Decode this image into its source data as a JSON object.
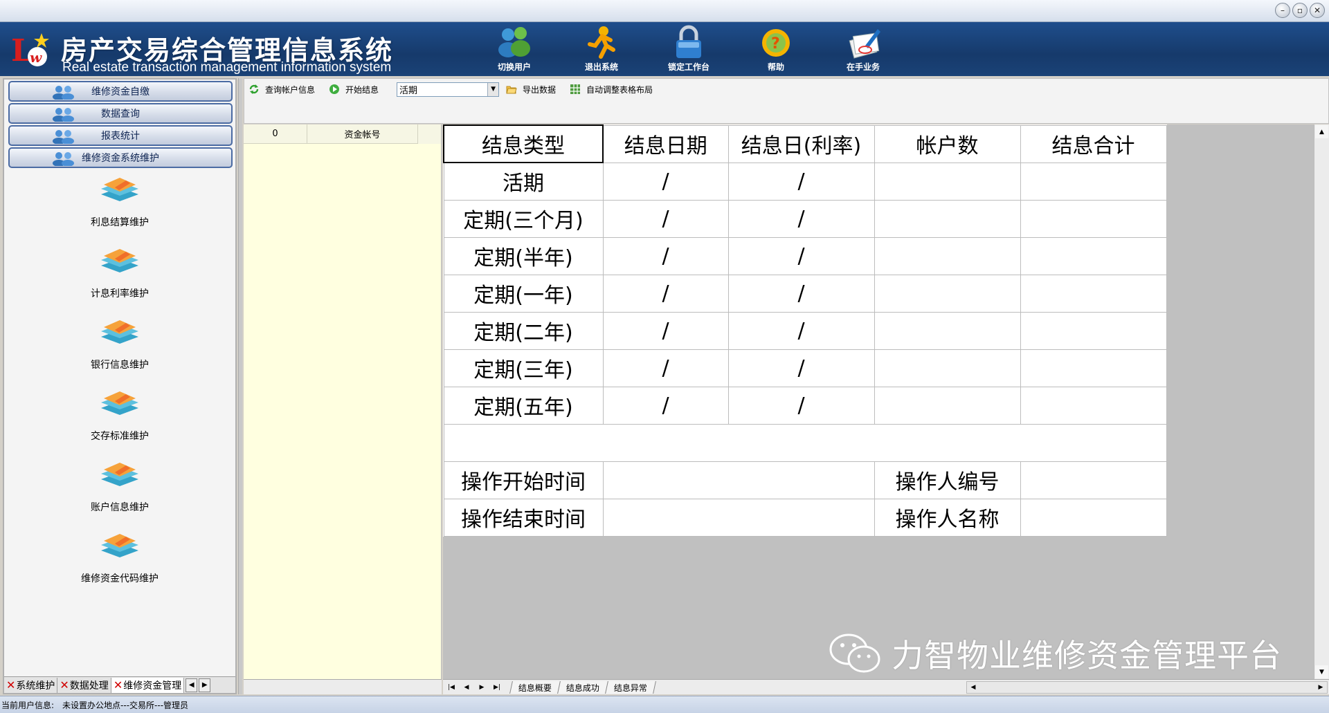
{
  "window": {
    "minimize": "–",
    "maximize": "▫",
    "close": "✕"
  },
  "banner": {
    "logo_text": "LW",
    "title": "房产交易综合管理信息系统",
    "subtitle": "Real estate transaction management information system",
    "nav": [
      {
        "label": "切换用户",
        "icon": "users-icon"
      },
      {
        "label": "退出系统",
        "icon": "exit-icon"
      },
      {
        "label": "锁定工作台",
        "icon": "lock-icon"
      },
      {
        "label": "帮助",
        "icon": "help-icon"
      },
      {
        "label": "在手业务",
        "icon": "business-icon"
      }
    ]
  },
  "sidebar": {
    "groups": [
      {
        "label": "维修资金自缴"
      },
      {
        "label": "数据查询"
      },
      {
        "label": "报表统计"
      },
      {
        "label": "维修资金系统维护"
      }
    ],
    "items": [
      {
        "label": "利息结算维护"
      },
      {
        "label": "计息利率维护"
      },
      {
        "label": "银行信息维护"
      },
      {
        "label": "交存标准维护"
      },
      {
        "label": "账户信息维护"
      },
      {
        "label": "维修资金代码维护"
      }
    ],
    "tabs": [
      {
        "label": "系统维护"
      },
      {
        "label": "数据处理"
      },
      {
        "label": "维修资金管理"
      }
    ]
  },
  "toolbar": {
    "query_label": "查询帐户信息",
    "start_label": "开始结息",
    "select_value": "活期",
    "export_label": "导出数据",
    "autofit_label": "自动调整表格布局"
  },
  "account_grid": {
    "col1": "0",
    "col2": "资金帐号"
  },
  "report": {
    "headers": [
      "结息类型",
      "结息日期",
      "结息日(利率)",
      "帐户数",
      "结息合计"
    ],
    "rows": [
      {
        "type": "活期",
        "date": "/",
        "rate": "/",
        "count": "",
        "total": ""
      },
      {
        "type": "定期(三个月)",
        "date": "/",
        "rate": "/",
        "count": "",
        "total": ""
      },
      {
        "type": "定期(半年)",
        "date": "/",
        "rate": "/",
        "count": "",
        "total": ""
      },
      {
        "type": "定期(一年)",
        "date": "/",
        "rate": "/",
        "count": "",
        "total": ""
      },
      {
        "type": "定期(二年)",
        "date": "/",
        "rate": "/",
        "count": "",
        "total": ""
      },
      {
        "type": "定期(三年)",
        "date": "/",
        "rate": "/",
        "count": "",
        "total": ""
      },
      {
        "type": "定期(五年)",
        "date": "/",
        "rate": "/",
        "count": "",
        "total": ""
      }
    ],
    "op_start_label": "操作开始时间",
    "op_end_label": "操作结束时间",
    "op_id_label": "操作人编号",
    "op_name_label": "操作人名称",
    "op_start_value": "",
    "op_end_value": "",
    "op_id_value": "",
    "op_name_value": ""
  },
  "sheet_tabs": [
    {
      "label": "结息概要"
    },
    {
      "label": "结息成功"
    },
    {
      "label": "结息异常"
    }
  ],
  "status": {
    "label": "当前用户信息:",
    "value": "未设置办公地点---交易所---管理员"
  },
  "watermark": {
    "text": "力智物业维修资金管理平台"
  }
}
